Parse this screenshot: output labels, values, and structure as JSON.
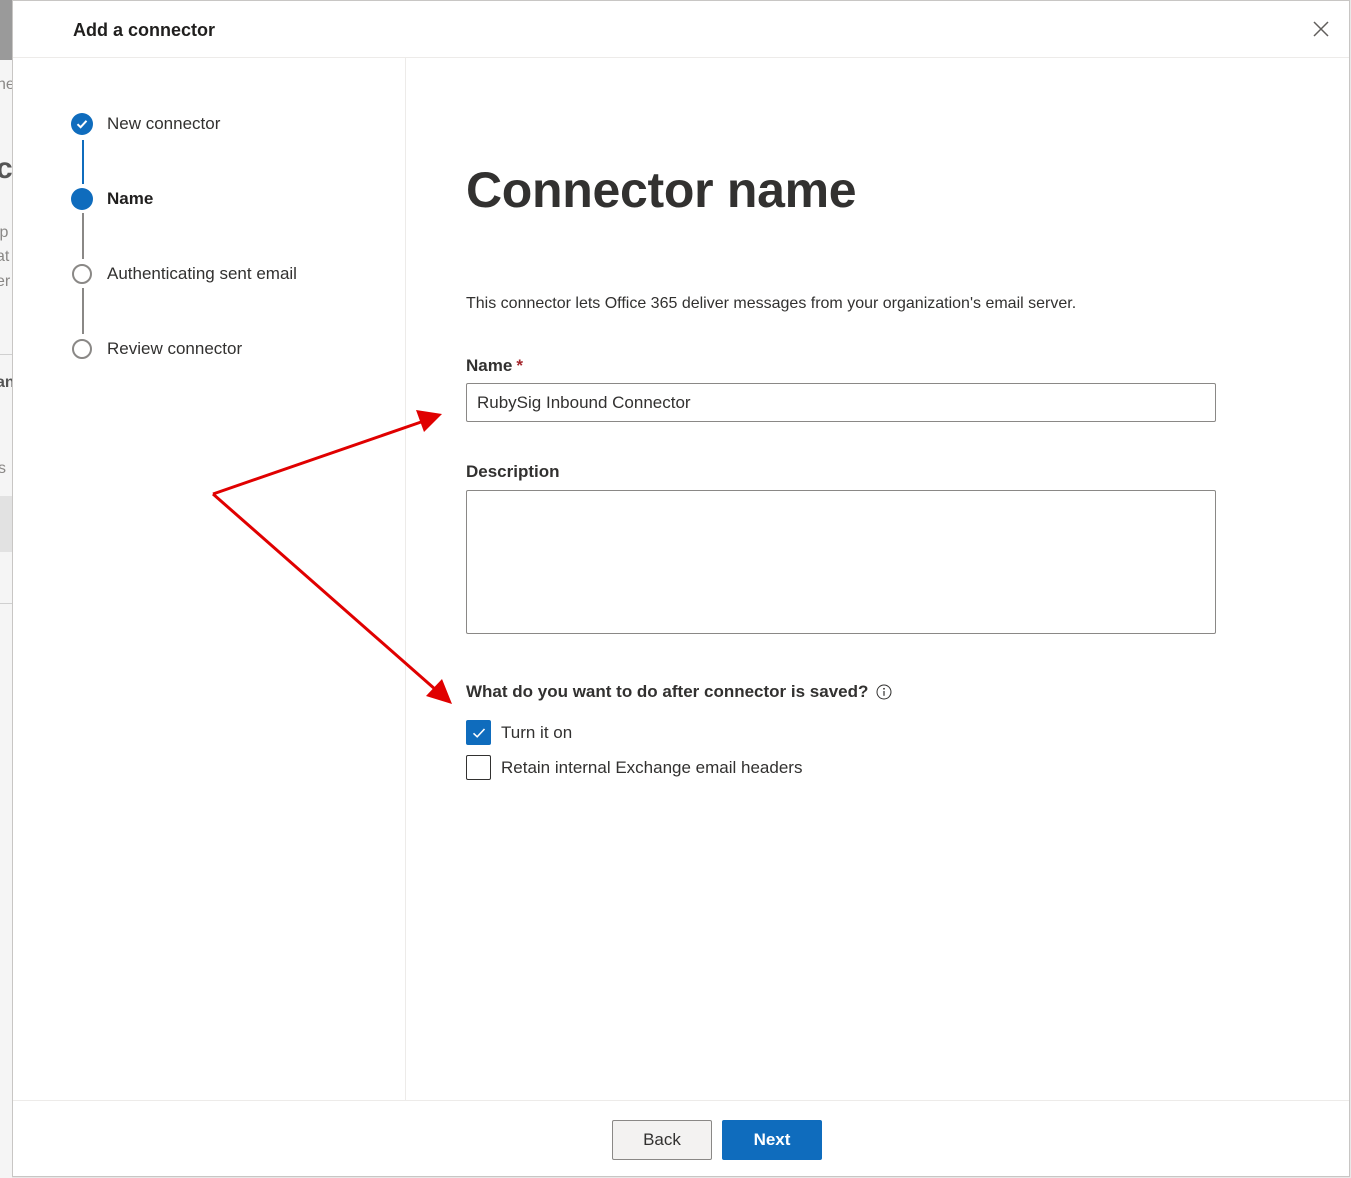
{
  "dialog": {
    "title": "Add a connector",
    "close_icon": "close-icon"
  },
  "steps": [
    {
      "label": "New connector",
      "state": "completed"
    },
    {
      "label": "Name",
      "state": "current"
    },
    {
      "label": "Authenticating sent email",
      "state": "pending"
    },
    {
      "label": "Review connector",
      "state": "pending"
    }
  ],
  "main": {
    "title": "Connector name",
    "intro": "This connector lets Office 365 deliver messages from your organization's email server.",
    "name_label": "Name",
    "name_required_marker": "*",
    "name_value": "RubySig Inbound Connector",
    "description_label": "Description",
    "description_value": "",
    "question": "What do you want to do after connector is saved?",
    "options": [
      {
        "label": "Turn it on",
        "checked": true
      },
      {
        "label": "Retain internal Exchange email headers",
        "checked": false
      }
    ]
  },
  "footer": {
    "back_label": "Back",
    "next_label": "Next"
  },
  "background_fragments": [
    "ne",
    "c",
    "lp",
    "at",
    "er",
    "an",
    "s"
  ],
  "colors": {
    "accent": "#0f6cbd",
    "annotation_arrow": "#e00000",
    "required": "#a4262c"
  }
}
